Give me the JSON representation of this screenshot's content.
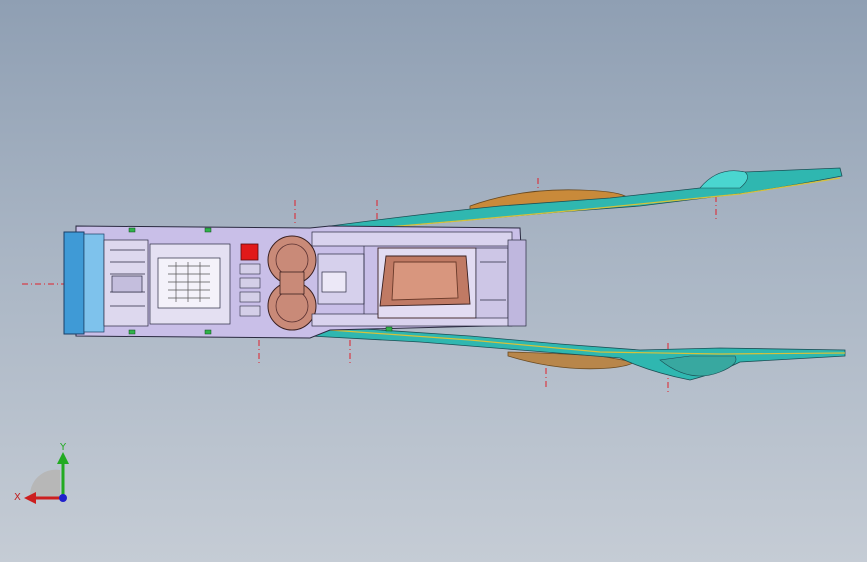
{
  "viewport": {
    "background_top": "#8f9fb3",
    "background_bottom": "#c5ccd5"
  },
  "model": {
    "colors": {
      "console_body": "#c9bfe8",
      "front_panel": "#3f9ad6",
      "cupholder": "#c98a78",
      "storage_bin": "#c07a64",
      "red_button": "#e11919",
      "armrest_trim": "#2fb7b0",
      "armrest_pad": "#c98a3a",
      "centerline": "#e0202a"
    }
  },
  "triad": {
    "y_label": "Y",
    "x_label": "X",
    "icon": "view-orientation-triad-icon"
  }
}
